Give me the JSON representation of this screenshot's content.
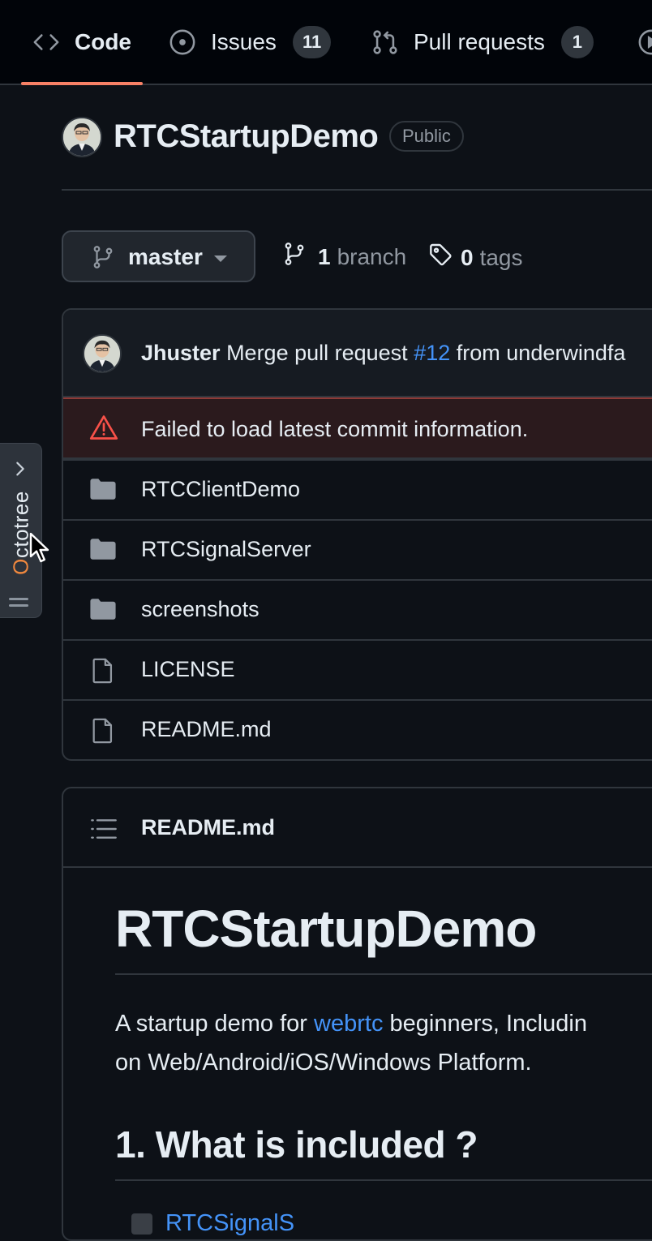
{
  "nav": {
    "tabs": [
      {
        "label": "Code",
        "icon": "code-icon",
        "active": true
      },
      {
        "label": "Issues",
        "icon": "issue-opened-icon",
        "count": "11"
      },
      {
        "label": "Pull requests",
        "icon": "git-pull-request-icon",
        "count": "1"
      }
    ]
  },
  "repo": {
    "name": "RTCStartupDemo",
    "visibility": "Public"
  },
  "branch": {
    "current": "master",
    "branches_count": "1",
    "branches_label": "branch",
    "tags_count": "0",
    "tags_label": "tags"
  },
  "commit": {
    "author": "Jhuster",
    "message_prefix": "Merge pull request",
    "pr_ref": "#12",
    "message_suffix": "from underwindfa"
  },
  "error": {
    "message": "Failed to load latest commit information."
  },
  "files": [
    {
      "name": "RTCClientDemo",
      "type": "folder"
    },
    {
      "name": "RTCSignalServer",
      "type": "folder"
    },
    {
      "name": "screenshots",
      "type": "folder"
    },
    {
      "name": "LICENSE",
      "type": "file"
    },
    {
      "name": "README.md",
      "type": "file"
    }
  ],
  "readme": {
    "file_title": "README.md",
    "h1": "RTCStartupDemo",
    "intro_prefix": "A startup demo for",
    "intro_link": "webrtc",
    "intro_suffix": "beginners, Includin",
    "intro_line2": "on Web/Android/iOS/Windows Platform.",
    "h2": "1. What is included ?",
    "list_item_partial": "RTCSignalS"
  },
  "octotree": {
    "label_first": "O",
    "label_rest": "ctotree"
  },
  "colors": {
    "background": "#0d1117",
    "accent_underline": "#f78166",
    "link": "#4493f8",
    "error_icon": "#f85149",
    "octotree_orange": "#f0883e"
  }
}
